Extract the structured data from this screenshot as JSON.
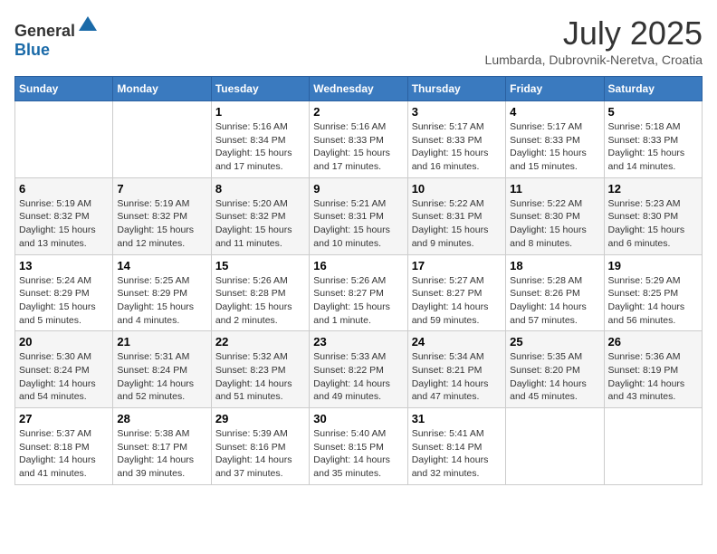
{
  "header": {
    "logo_general": "General",
    "logo_blue": "Blue",
    "month": "July 2025",
    "location": "Lumbarda, Dubrovnik-Neretva, Croatia"
  },
  "days_of_week": [
    "Sunday",
    "Monday",
    "Tuesday",
    "Wednesday",
    "Thursday",
    "Friday",
    "Saturday"
  ],
  "weeks": [
    [
      {
        "day": "",
        "info": ""
      },
      {
        "day": "",
        "info": ""
      },
      {
        "day": "1",
        "info": "Sunrise: 5:16 AM\nSunset: 8:34 PM\nDaylight: 15 hours and 17 minutes."
      },
      {
        "day": "2",
        "info": "Sunrise: 5:16 AM\nSunset: 8:33 PM\nDaylight: 15 hours and 17 minutes."
      },
      {
        "day": "3",
        "info": "Sunrise: 5:17 AM\nSunset: 8:33 PM\nDaylight: 15 hours and 16 minutes."
      },
      {
        "day": "4",
        "info": "Sunrise: 5:17 AM\nSunset: 8:33 PM\nDaylight: 15 hours and 15 minutes."
      },
      {
        "day": "5",
        "info": "Sunrise: 5:18 AM\nSunset: 8:33 PM\nDaylight: 15 hours and 14 minutes."
      }
    ],
    [
      {
        "day": "6",
        "info": "Sunrise: 5:19 AM\nSunset: 8:32 PM\nDaylight: 15 hours and 13 minutes."
      },
      {
        "day": "7",
        "info": "Sunrise: 5:19 AM\nSunset: 8:32 PM\nDaylight: 15 hours and 12 minutes."
      },
      {
        "day": "8",
        "info": "Sunrise: 5:20 AM\nSunset: 8:32 PM\nDaylight: 15 hours and 11 minutes."
      },
      {
        "day": "9",
        "info": "Sunrise: 5:21 AM\nSunset: 8:31 PM\nDaylight: 15 hours and 10 minutes."
      },
      {
        "day": "10",
        "info": "Sunrise: 5:22 AM\nSunset: 8:31 PM\nDaylight: 15 hours and 9 minutes."
      },
      {
        "day": "11",
        "info": "Sunrise: 5:22 AM\nSunset: 8:30 PM\nDaylight: 15 hours and 8 minutes."
      },
      {
        "day": "12",
        "info": "Sunrise: 5:23 AM\nSunset: 8:30 PM\nDaylight: 15 hours and 6 minutes."
      }
    ],
    [
      {
        "day": "13",
        "info": "Sunrise: 5:24 AM\nSunset: 8:29 PM\nDaylight: 15 hours and 5 minutes."
      },
      {
        "day": "14",
        "info": "Sunrise: 5:25 AM\nSunset: 8:29 PM\nDaylight: 15 hours and 4 minutes."
      },
      {
        "day": "15",
        "info": "Sunrise: 5:26 AM\nSunset: 8:28 PM\nDaylight: 15 hours and 2 minutes."
      },
      {
        "day": "16",
        "info": "Sunrise: 5:26 AM\nSunset: 8:27 PM\nDaylight: 15 hours and 1 minute."
      },
      {
        "day": "17",
        "info": "Sunrise: 5:27 AM\nSunset: 8:27 PM\nDaylight: 14 hours and 59 minutes."
      },
      {
        "day": "18",
        "info": "Sunrise: 5:28 AM\nSunset: 8:26 PM\nDaylight: 14 hours and 57 minutes."
      },
      {
        "day": "19",
        "info": "Sunrise: 5:29 AM\nSunset: 8:25 PM\nDaylight: 14 hours and 56 minutes."
      }
    ],
    [
      {
        "day": "20",
        "info": "Sunrise: 5:30 AM\nSunset: 8:24 PM\nDaylight: 14 hours and 54 minutes."
      },
      {
        "day": "21",
        "info": "Sunrise: 5:31 AM\nSunset: 8:24 PM\nDaylight: 14 hours and 52 minutes."
      },
      {
        "day": "22",
        "info": "Sunrise: 5:32 AM\nSunset: 8:23 PM\nDaylight: 14 hours and 51 minutes."
      },
      {
        "day": "23",
        "info": "Sunrise: 5:33 AM\nSunset: 8:22 PM\nDaylight: 14 hours and 49 minutes."
      },
      {
        "day": "24",
        "info": "Sunrise: 5:34 AM\nSunset: 8:21 PM\nDaylight: 14 hours and 47 minutes."
      },
      {
        "day": "25",
        "info": "Sunrise: 5:35 AM\nSunset: 8:20 PM\nDaylight: 14 hours and 45 minutes."
      },
      {
        "day": "26",
        "info": "Sunrise: 5:36 AM\nSunset: 8:19 PM\nDaylight: 14 hours and 43 minutes."
      }
    ],
    [
      {
        "day": "27",
        "info": "Sunrise: 5:37 AM\nSunset: 8:18 PM\nDaylight: 14 hours and 41 minutes."
      },
      {
        "day": "28",
        "info": "Sunrise: 5:38 AM\nSunset: 8:17 PM\nDaylight: 14 hours and 39 minutes."
      },
      {
        "day": "29",
        "info": "Sunrise: 5:39 AM\nSunset: 8:16 PM\nDaylight: 14 hours and 37 minutes."
      },
      {
        "day": "30",
        "info": "Sunrise: 5:40 AM\nSunset: 8:15 PM\nDaylight: 14 hours and 35 minutes."
      },
      {
        "day": "31",
        "info": "Sunrise: 5:41 AM\nSunset: 8:14 PM\nDaylight: 14 hours and 32 minutes."
      },
      {
        "day": "",
        "info": ""
      },
      {
        "day": "",
        "info": ""
      }
    ]
  ]
}
